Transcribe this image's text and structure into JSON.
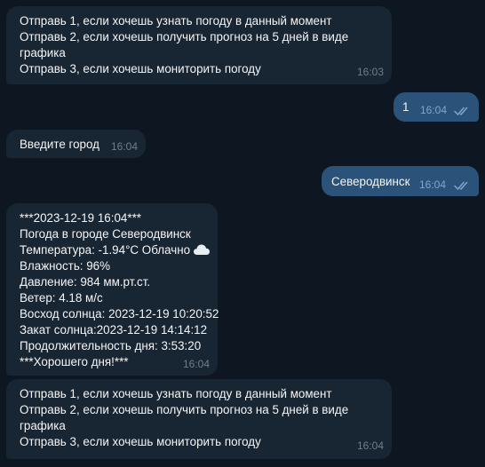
{
  "messages": [
    {
      "direction": "incoming",
      "lines": [
        "Отправь 1, если хочешь узнать погоду в данный момент",
        "Отправь 2, если хочешь получить прогноз на 5 дней в виде",
        "графика",
        "Отправь 3, если хочешь мониторить погоду"
      ],
      "time": "16:03"
    },
    {
      "direction": "outgoing",
      "text": "1",
      "time": "16:04",
      "status": "read"
    },
    {
      "direction": "incoming",
      "text": "Введите город",
      "time": "16:04"
    },
    {
      "direction": "outgoing",
      "text": "Северодвинск",
      "time": "16:04",
      "status": "read"
    },
    {
      "direction": "incoming",
      "lines": [
        "***2023-12-19 16:04***",
        "Погода в городе Северодвинск",
        "Температура: -1.94°C Облачно",
        "Влажность: 96%",
        "Давление: 984 мм.рт.ст.",
        "Ветер: 4.18 м/с",
        "Восход солнца: 2023-12-19 10:20:52",
        "Закат солнца:2023-12-19 14:14:12",
        "Продолжительность дня: 3:53:20",
        "***Хорошего дня!***"
      ],
      "weather_icon": "cloud-icon",
      "time": "16:04"
    },
    {
      "direction": "incoming",
      "lines": [
        "Отправь 1, если хочешь узнать погоду в данный момент",
        "Отправь 2, если хочешь получить прогноз на 5 дней в виде",
        "графика",
        "Отправь 3, если хочешь мониторить погоду"
      ],
      "time": "16:04"
    }
  ],
  "colors": {
    "background": "#0e1621",
    "incoming_bubble": "#182533",
    "outgoing_bubble": "#2b5278",
    "text": "#f5f5f5",
    "read_ticks": "#7da8d3"
  }
}
